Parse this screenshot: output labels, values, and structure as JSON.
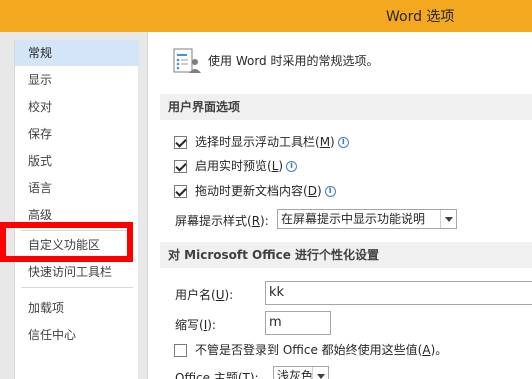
{
  "window": {
    "title": "Word 选项"
  },
  "nav": {
    "items": [
      {
        "label": "常规",
        "selected": true
      },
      {
        "label": "显示"
      },
      {
        "label": "校对"
      },
      {
        "label": "保存"
      },
      {
        "label": "版式"
      },
      {
        "label": "语言"
      },
      {
        "label": "高级"
      },
      {
        "label": "自定义功能区",
        "highlighted": true
      },
      {
        "label": "快速访问工具栏"
      },
      {
        "label": "加载项"
      },
      {
        "label": "信任中心"
      }
    ]
  },
  "main": {
    "header_text": "使用 Word 时采用的常规选项。",
    "ui_section": {
      "title": "用户界面选项",
      "opt1": {
        "label": "选择时显示浮动工具栏(",
        "key": "M",
        "suffix": ")",
        "checked": true
      },
      "opt2": {
        "label": "启用实时预览(",
        "key": "L",
        "suffix": ")",
        "checked": true
      },
      "opt3": {
        "label": "拖动时更新文档内容(",
        "key": "D",
        "suffix": ")",
        "checked": true
      },
      "screentip": {
        "label": "屏幕提示样式(",
        "key": "R",
        "suffix": "):",
        "value": "在屏幕提示中显示功能说明"
      }
    },
    "personal_section": {
      "title": "对 Microsoft Office 进行个性化设置",
      "username": {
        "label": "用户名(",
        "key": "U",
        "suffix": "):",
        "value": "kk"
      },
      "initials": {
        "label": "缩写(",
        "key": "I",
        "suffix": "):",
        "value": "m"
      },
      "always_use": {
        "label": "不管是否登录到 Office 都始终使用这些值(",
        "key": "A",
        "suffix": ")。",
        "checked": false
      },
      "theme": {
        "label": "Office 主题(",
        "key": "T",
        "suffix": "):",
        "value": "浅灰色"
      }
    }
  },
  "colors": {
    "titlebar": "#f4a81f",
    "nav_selected": "#d3e5f7",
    "highlight_box": "#ff0000",
    "info_icon": "#3d7fc6"
  }
}
